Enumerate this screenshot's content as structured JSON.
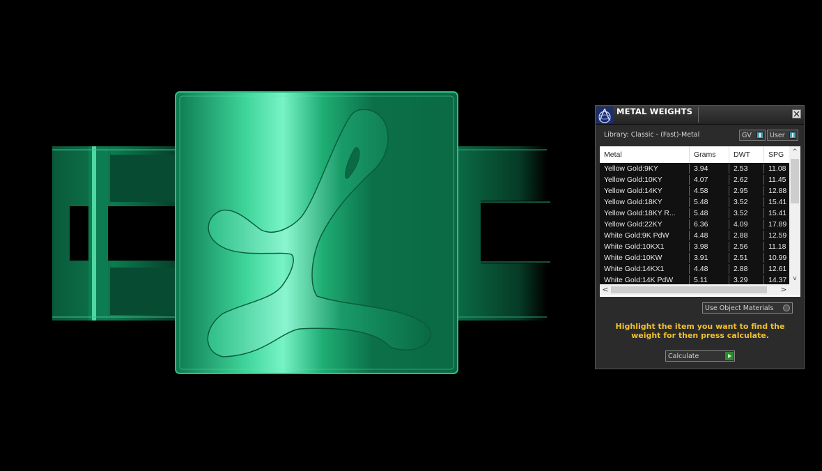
{
  "panel": {
    "title": "METAL WEIGHTS",
    "library_label": "Library: Classic - (Fast)-Metal",
    "gv_label": "GV",
    "user_label": "User",
    "columns": [
      "Metal",
      "Grams",
      "DWT",
      "SPG"
    ],
    "rows": [
      [
        "Yellow Gold:9KY",
        "3.94",
        "2.53",
        "11.08"
      ],
      [
        "Yellow Gold:10KY",
        "4.07",
        "2.62",
        "11.45"
      ],
      [
        "Yellow Gold:14KY",
        "4.58",
        "2.95",
        "12.88"
      ],
      [
        "Yellow Gold:18KY",
        "5.48",
        "3.52",
        "15.41"
      ],
      [
        "Yellow Gold:18KY R...",
        "5.48",
        "3.52",
        "15.41"
      ],
      [
        "Yellow Gold:22KY",
        "6.36",
        "4.09",
        "17.89"
      ],
      [
        "White Gold:9K PdW",
        "4.48",
        "2.88",
        "12.59"
      ],
      [
        "White Gold:10KX1",
        "3.98",
        "2.56",
        "11.18"
      ],
      [
        "White Gold:10KW",
        "3.91",
        "2.51",
        "10.99"
      ],
      [
        "White Gold:14KX1",
        "4.48",
        "2.88",
        "12.61"
      ],
      [
        "White Gold:14K PdW",
        "5.11",
        "3.29",
        "14.37"
      ]
    ],
    "use_object_materials": "Use Object Materials",
    "hint": "Highlight the item you want to find the weight for then press calculate.",
    "calculate": "Calculate",
    "scroll_up": "^",
    "scroll_down": "v",
    "scroll_left": "<",
    "scroll_right": ">"
  },
  "colors": {
    "model_green": "#0f8a5c",
    "model_highlight": "#6ff0c0",
    "hint_yellow": "#f2c12e"
  },
  "icons": [
    "app-logo-icon",
    "close-icon",
    "toggle-icon",
    "radio-icon",
    "play-icon"
  ]
}
